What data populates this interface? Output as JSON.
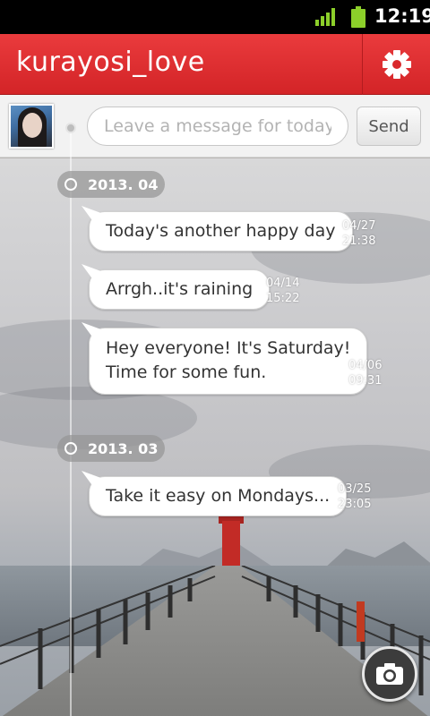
{
  "status_bar": {
    "time": "12:19",
    "signal_icon": "signal-icon",
    "battery_icon": "battery-icon"
  },
  "app_bar": {
    "title": "kurayosi_love",
    "settings_icon": "gear-icon",
    "accent": "#e0292c"
  },
  "compose": {
    "placeholder": "Leave a message for today",
    "send_label": "Send"
  },
  "timeline": {
    "groups": [
      {
        "month": "2013. 04",
        "posts": [
          {
            "text": "Today's another happy day",
            "date": "04/27",
            "time": "21:38"
          },
          {
            "text": "Arrgh..it's raining",
            "date": "04/14",
            "time": "15:22"
          },
          {
            "text": "Hey everyone! It's Saturday! Time for some fun.",
            "line1": "Hey everyone! It's Saturday!",
            "line2": "Time for some fun.",
            "date": "04/06",
            "time": "09:31"
          }
        ]
      },
      {
        "month": "2013. 03",
        "posts": [
          {
            "text": "Take it easy on Mondays...",
            "date": "03/25",
            "time": "23:05"
          }
        ]
      }
    ]
  },
  "camera": {
    "icon": "camera-icon"
  }
}
